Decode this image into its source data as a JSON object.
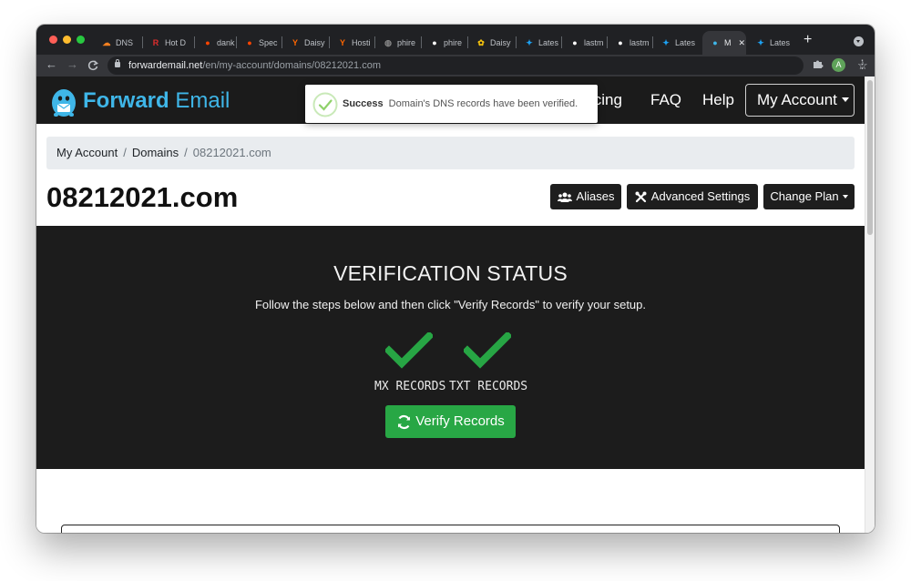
{
  "browser": {
    "tabs": [
      {
        "title": "DNS",
        "icon": "cloud-icon",
        "color": "#f38020"
      },
      {
        "title": "Hot D",
        "icon": "r-icon",
        "color": "#e02d2d"
      },
      {
        "title": "dank",
        "icon": "reddit-icon",
        "color": "#ff4500"
      },
      {
        "title": "Spec",
        "icon": "reddit-icon",
        "color": "#ff4500"
      },
      {
        "title": "Daisy",
        "icon": "ycombinator-icon",
        "color": "#ff6600"
      },
      {
        "title": "Hosti",
        "icon": "ycombinator-icon",
        "color": "#ff6600"
      },
      {
        "title": "phire",
        "icon": "globe-icon",
        "color": "#8a8a8a"
      },
      {
        "title": "phire",
        "icon": "github-icon",
        "color": "#ffffff"
      },
      {
        "title": "Daisy",
        "icon": "flower-icon",
        "color": "#f4c20d"
      },
      {
        "title": "Lates",
        "icon": "twitter-icon",
        "color": "#1da1f2"
      },
      {
        "title": "lastm",
        "icon": "github-icon",
        "color": "#ffffff"
      },
      {
        "title": "lastm",
        "icon": "github-icon",
        "color": "#ffffff"
      },
      {
        "title": "Lates",
        "icon": "twitter-icon",
        "color": "#1da1f2"
      },
      {
        "title": "M",
        "icon": "forward-email-icon",
        "color": "#3fb6e8",
        "active": true
      },
      {
        "title": "Lates",
        "icon": "twitter-icon",
        "color": "#1da1f2"
      }
    ],
    "url_host": "forwardemail.net",
    "url_path": "/en/my-account/domains/08212021.com",
    "profile_initial": "A"
  },
  "navbar": {
    "brand_bold": "Forward",
    "brand_rest": " Email",
    "links": {
      "pricing_partial": "icing",
      "faq": "FAQ",
      "help": "Help"
    },
    "account_button": "My Account"
  },
  "toast": {
    "status": "Success",
    "message": "Domain's DNS records have been verified."
  },
  "breadcrumb": {
    "items": [
      "My Account",
      "Domains"
    ],
    "current": "08212021.com",
    "separator": "/"
  },
  "domain": {
    "name": "08212021.com",
    "buttons": {
      "aliases": "Aliases",
      "advanced": "Advanced Settings",
      "change_plan": "Change Plan"
    }
  },
  "verification": {
    "title": "VERIFICATION STATUS",
    "subtitle": "Follow the steps below and then click \"Verify Records\" to verify your setup.",
    "records": [
      {
        "label": "MX RECORDS",
        "status": "verified"
      },
      {
        "label": "TXT RECORDS",
        "status": "verified"
      }
    ],
    "verify_button": "Verify Records"
  },
  "colors": {
    "brand": "#3fb6e8",
    "success": "#28a745",
    "dark": "#1c1c1c"
  }
}
